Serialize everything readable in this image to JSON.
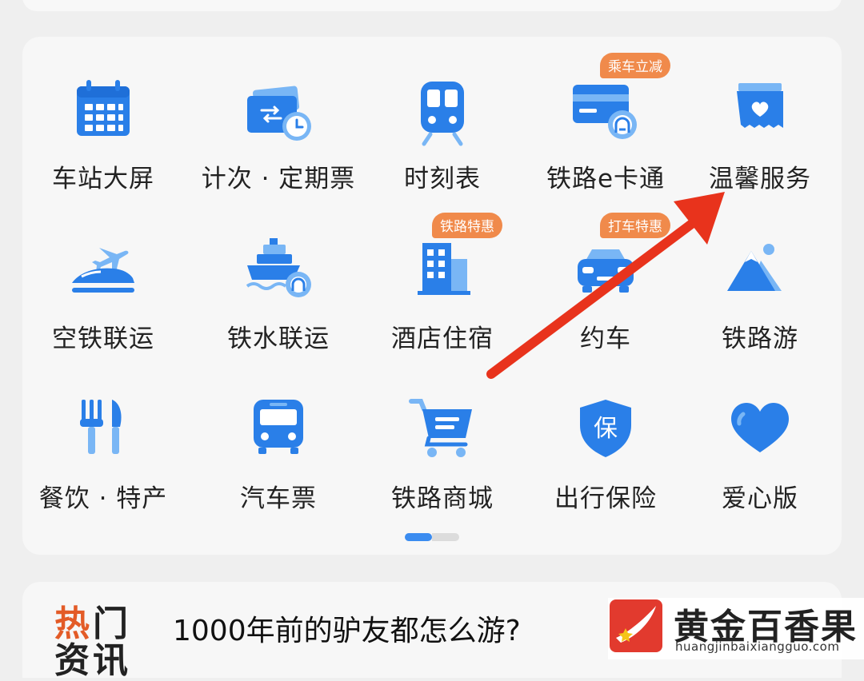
{
  "grid": {
    "rows": [
      [
        {
          "label": "车站大屏",
          "icon": "calendar-icon"
        },
        {
          "label": "计次 · 定期票",
          "icon": "ticket-clock-icon"
        },
        {
          "label": "时刻表",
          "icon": "train-icon"
        },
        {
          "label": "铁路e卡通",
          "icon": "card-railway-icon",
          "badge": "乘车立减"
        },
        {
          "label": "温馨服务",
          "icon": "heart-bag-icon"
        }
      ],
      [
        {
          "label": "空铁联运",
          "icon": "plane-train-icon"
        },
        {
          "label": "铁水联运",
          "icon": "ship-railway-icon"
        },
        {
          "label": "酒店住宿",
          "icon": "hotel-icon",
          "badge": "铁路特惠"
        },
        {
          "label": "约车",
          "icon": "car-icon",
          "badge": "打车特惠"
        },
        {
          "label": "铁路游",
          "icon": "mountain-icon"
        }
      ],
      [
        {
          "label": "餐饮 · 特产",
          "icon": "fork-knife-icon"
        },
        {
          "label": "汽车票",
          "icon": "bus-icon"
        },
        {
          "label": "铁路商城",
          "icon": "shopping-cart-icon"
        },
        {
          "label": "出行保险",
          "icon": "shield-icon",
          "shield_char": "保"
        },
        {
          "label": "爱心版",
          "icon": "heart-icon"
        }
      ]
    ]
  },
  "pager": {
    "current": 1,
    "total": 2
  },
  "hot": {
    "label_line1_a": "热",
    "label_line1_b": "门",
    "label_line2": "资讯",
    "title": "1000年前的驴友都怎么游?"
  },
  "watermark": {
    "text": "黄金百香果",
    "url": "huangjinbaixiangguo.com"
  },
  "colors": {
    "icon_blue": "#2a7fe8",
    "icon_light": "#79b6f5",
    "badge": "#f08a4b",
    "arrow": "#e8331c",
    "accent_red": "#e35b27"
  }
}
